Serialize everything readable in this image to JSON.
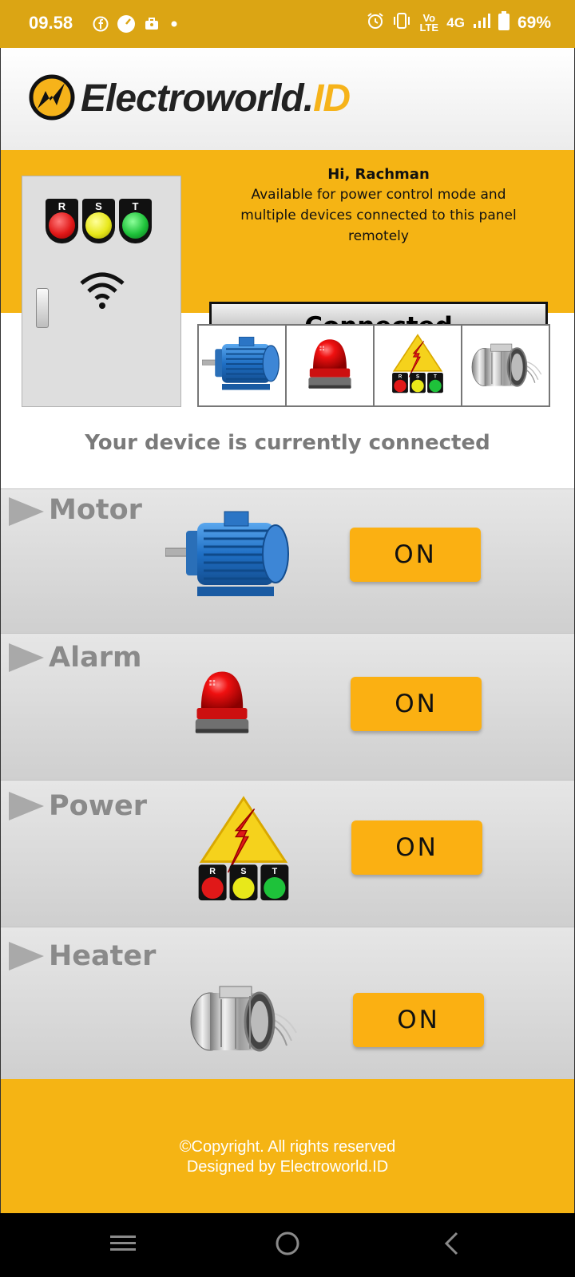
{
  "status_bar": {
    "time": "09.58",
    "volte": "Vo LTE",
    "network": "4G",
    "battery": "69%"
  },
  "header": {
    "brand_main": "Electroworld.",
    "brand_suffix": "ID"
  },
  "banner": {
    "greeting": "Hi, Rachman",
    "description": "Available for power control mode and multiple devices connected to this panel remotely",
    "connection_button": "Connected"
  },
  "panel": {
    "lamps": [
      {
        "label": "R",
        "color": "#e01818"
      },
      {
        "label": "S",
        "color": "#e8e81a"
      },
      {
        "label": "T",
        "color": "#1ec23a"
      }
    ]
  },
  "status_message": "Your device is currently connected",
  "devices": [
    {
      "name": "Motor",
      "button": "ON",
      "icon": "electric-motor-icon"
    },
    {
      "name": "Alarm",
      "button": "ON",
      "icon": "siren-light-icon"
    },
    {
      "name": "Power",
      "button": "ON",
      "icon": "high-voltage-rst-icon"
    },
    {
      "name": "Heater",
      "button": "ON",
      "icon": "band-heater-icon"
    }
  ],
  "footer": {
    "copyright": "©Copyright. All rights reserved",
    "designed_by": "Designed by Electroworld.ID"
  },
  "colors": {
    "status_bar": "#dba514",
    "accent": "#f5b414",
    "button": "#fbb012"
  }
}
